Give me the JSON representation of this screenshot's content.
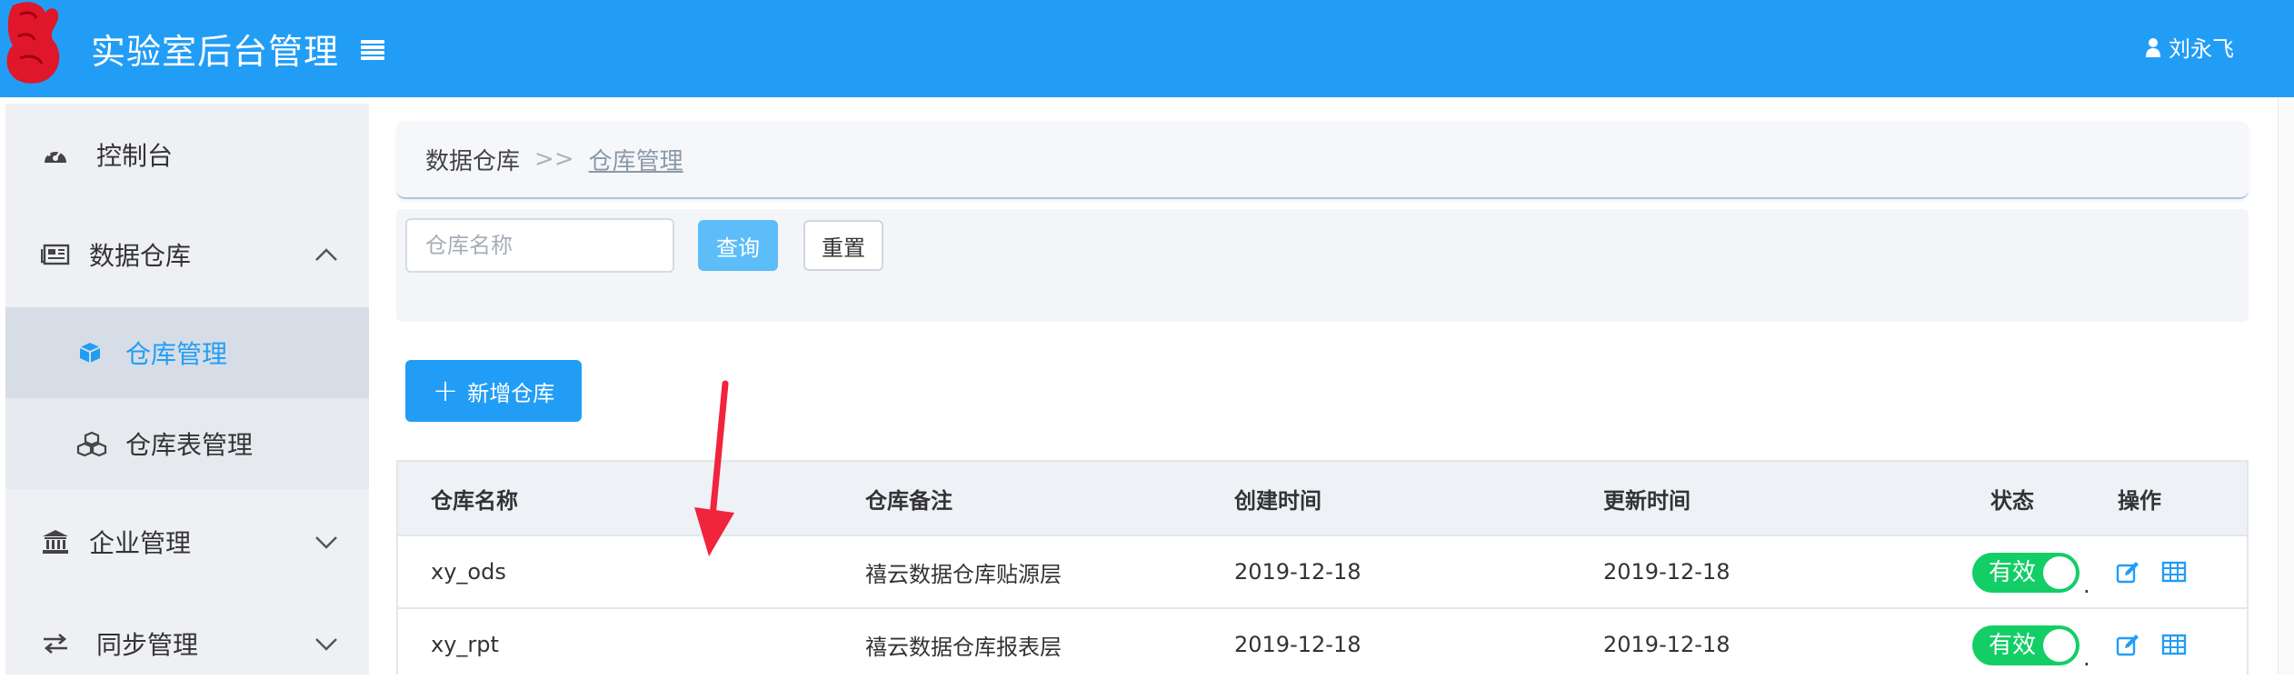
{
  "header": {
    "title": "实验室后台管理",
    "user_name": "刘永飞",
    "bg_color": "#229df6"
  },
  "sidebar": {
    "items": [
      {
        "label": "控制台",
        "icon": "dashboard-icon"
      },
      {
        "label": "数据仓库",
        "icon": "newspaper-icon",
        "expanded": true
      },
      {
        "label": "仓库管理",
        "icon": "cube-icon",
        "active": true
      },
      {
        "label": "仓库表管理",
        "icon": "cubes-icon"
      },
      {
        "label": "企业管理",
        "icon": "bank-icon"
      },
      {
        "label": "同步管理",
        "icon": "exchange-icon"
      }
    ]
  },
  "breadcrumb": {
    "root": "数据仓库",
    "separator": ">>",
    "current": "仓库管理"
  },
  "filter": {
    "name_placeholder": "仓库名称",
    "query_label": "查询",
    "reset_label": "重置"
  },
  "toolbar": {
    "add_label": "新增仓库"
  },
  "table": {
    "columns": [
      "仓库名称",
      "仓库备注",
      "创建时间",
      "更新时间",
      "状态",
      "操作"
    ],
    "rows": [
      {
        "name": "xy_ods",
        "remark": "禧云数据仓库贴源层",
        "created": "2019-12-18",
        "updated": "2019-12-18",
        "status": "有效"
      },
      {
        "name": "xy_rpt",
        "remark": "禧云数据仓库报表层",
        "created": "2019-12-18",
        "updated": "2019-12-18",
        "status": "有效"
      }
    ]
  },
  "colors": {
    "accent": "#229df6",
    "status_on": "#13ce66",
    "annotation_arrow": "#f0243c"
  }
}
